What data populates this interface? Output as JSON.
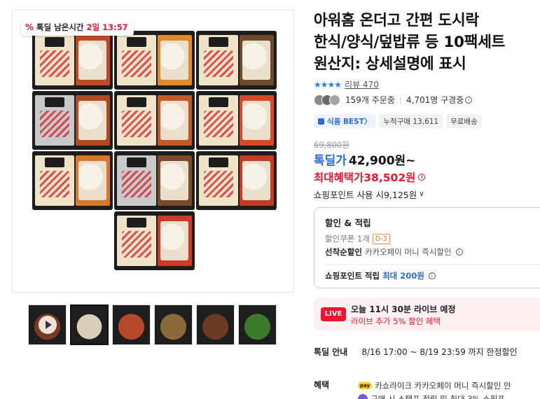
{
  "deal_badge": {
    "label": "톡딜 남은시간",
    "time": "2일 13:57"
  },
  "gallery": {
    "trays": [
      {
        "label_color": "#efe3c8",
        "food_color": "#c24a22"
      },
      {
        "label_color": "#efe3c8",
        "food_color": "#e08a2a"
      },
      {
        "label_color": "#efe3c8",
        "food_color": "#6b4b2a"
      },
      {
        "label_color": "#c9c9c9",
        "food_color": "#b04a24"
      },
      {
        "label_color": "#efe3c8",
        "food_color": "#c25a28"
      },
      {
        "label_color": "#efe3c8",
        "food_color": "#d24a2a"
      },
      {
        "label_color": "#efe3c8",
        "food_color": "#d8782a"
      },
      {
        "label_color": "#c9c9c9",
        "food_color": "#7a4a2a"
      },
      {
        "label_color": "#efe3c8",
        "food_color": "#c43a22"
      },
      {
        "label_color": "#efe3c8",
        "food_color": "#cf3a28"
      }
    ],
    "thumbnails": [
      {
        "kind": "video",
        "color": "#7a3a20"
      },
      {
        "kind": "image",
        "color": "#d9cfb8",
        "selected": true
      },
      {
        "kind": "image",
        "color": "#b8482a"
      },
      {
        "kind": "image",
        "color": "#8a6a3a"
      },
      {
        "kind": "image",
        "color": "#6a3a22"
      },
      {
        "kind": "image",
        "color": "#3c7a2c"
      }
    ]
  },
  "product": {
    "title_line1": "아워홈 온더고 간편 도시락",
    "title_line2": "한식/양식/덮밥류 등 10팩세트",
    "title_line3": "원산지: 상세설명에 표시",
    "stars": "★★★★",
    "review": "리뷰 470",
    "orders": "159개 주문중",
    "subscribers": "4,701명 구경중",
    "tags": [
      "식품 BEST〉",
      "누적구매 13,611",
      "무료배송"
    ],
    "original_price": "69,800원",
    "deal_label": "톡딜가",
    "deal_price": "42,900원~",
    "max_benefit_price": "최대혜택가38,502원",
    "point_use": "쇼핑포인트 사용 시9,125원"
  },
  "benefit_box": {
    "title": "할인 & 적립",
    "coupon": "할인쿠폰 1개",
    "dday": "D-3",
    "first_label": "선착순할인",
    "first_value": "카카오페이 머니 즉시할인",
    "point_label": "쇼핑포인트 적립",
    "point_value": "최대 200원"
  },
  "live": {
    "badge": "LIVE",
    "line1": "오늘 11시 30분 라이브 예정",
    "line2": "라이브 추가 5% 할인 혜택"
  },
  "deal_info": {
    "label": "톡딜 안내",
    "value": "8/16 17:00 ~ 8/19 23:59 까지 한정할인"
  },
  "benefits": {
    "label": "혜택",
    "npay": "pay",
    "line1": "카쇼라이크 카카오페이 머니 즉시할인 안",
    "line2": "구매 시 스탬프 적립 및 최대 3% 쇼핑포"
  },
  "colors": {
    "accent_blue": "#2a6dd7",
    "accent_red": "#f0142f"
  }
}
